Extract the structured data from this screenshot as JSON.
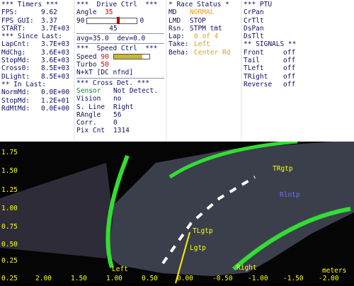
{
  "timers": {
    "header": "*** Timers ***",
    "fps_label": "FPS:",
    "fps": "9.62",
    "fpsgui_label": "FPS_GUI:",
    "fpsgui": "3.37",
    "start_label": "START:",
    "start": "3.7E+03",
    "since_header": "*** Since Last:",
    "lapcnt_label": "LapCnt:",
    "lapcnt": "3.7E+03",
    "mdchg_label": "MdChg:",
    "mdchg": "3.6E+03",
    "stopmd_label": "StopMd:",
    "stopmd": "3.6E+03",
    "cross0_label": "Cross0:",
    "cross0": "8.5E+03",
    "dlight_label": "DLight:",
    "dlight": "8.5E+03",
    "inlast_header": "** In Last:",
    "normmd_label": "NormMd:",
    "normmd": "0.0E+00",
    "stopmd2_label": "StopMd:",
    "stopmd2": "1.2E+01",
    "rdmtmd_label": "RdMtMd:",
    "rdmtmd": "0.0E+00"
  },
  "drive": {
    "header": "***  Drive Ctrl  ***",
    "angle_label": "Angle",
    "angle": "35",
    "range_min": "90",
    "range_max": "0",
    "angle_value": "45",
    "angle_level": 0.6,
    "avg": "avg=35.0  dev=0.0",
    "speed_header": "***  Speed Ctrl  ***",
    "speed_label": "Speed",
    "speed": "90",
    "speed_level": 0.8,
    "turbo_label": "Turbo",
    "turbo": "50",
    "nkt": "N+kT [DC nfnd]",
    "cross_header": "*** Cross Det. ***",
    "sensor_label": "Sensor",
    "sensor": "Not Detect.",
    "vision_label": "Vision",
    "vision": "no",
    "sline_label": "S. Line",
    "sline": "Right",
    "rangle_label": "RAngle",
    "rangle": "56",
    "corr_label": "Corr.",
    "corr": "0",
    "pix_label": "Pix Cnt",
    "pix": "1314"
  },
  "race": {
    "header": "* Race Status *",
    "md_label": "MD",
    "md": "NORMAL",
    "lmd_label": "LMD",
    "lmd": "STOP",
    "rsn_label": "Rsn.",
    "rsn": "STPM tmt",
    "lap_label": "Lap:",
    "lap": "0 of 4",
    "take_label": "Take:",
    "take": "Left",
    "beha_label": "Beha:",
    "beha": "Center Rd"
  },
  "ptu": {
    "header": "*** PTU",
    "items": [
      "CrPan",
      "CrTlt",
      "DsPan",
      "DsTlt"
    ],
    "signals_header": "** SIGNALS **",
    "signals": [
      {
        "name": "Front",
        "state": "off"
      },
      {
        "name": "Tail",
        "state": "off"
      },
      {
        "name": "TLeft",
        "state": "off"
      },
      {
        "name": "TRight",
        "state": "off"
      },
      {
        "name": "Reverse",
        "state": "off"
      }
    ]
  },
  "camera": {
    "y_ticks": [
      "1.75",
      "1.50",
      "1.25",
      "1.00",
      "0.75",
      "0.50",
      "0.25"
    ],
    "x_ticks": [
      "0.25",
      "2.00",
      "1.50",
      "1.00",
      "0.50",
      "0.00",
      "-0.50",
      "-1.00",
      "-1.50",
      "-2.00"
    ],
    "units": "meters",
    "labels": {
      "left": "Left",
      "right": "Right",
      "tlgtp": "TLgtp",
      "lgtp": "Lgtp",
      "trgtp": "TRgtp",
      "rlntp": "Rlntp"
    }
  }
}
